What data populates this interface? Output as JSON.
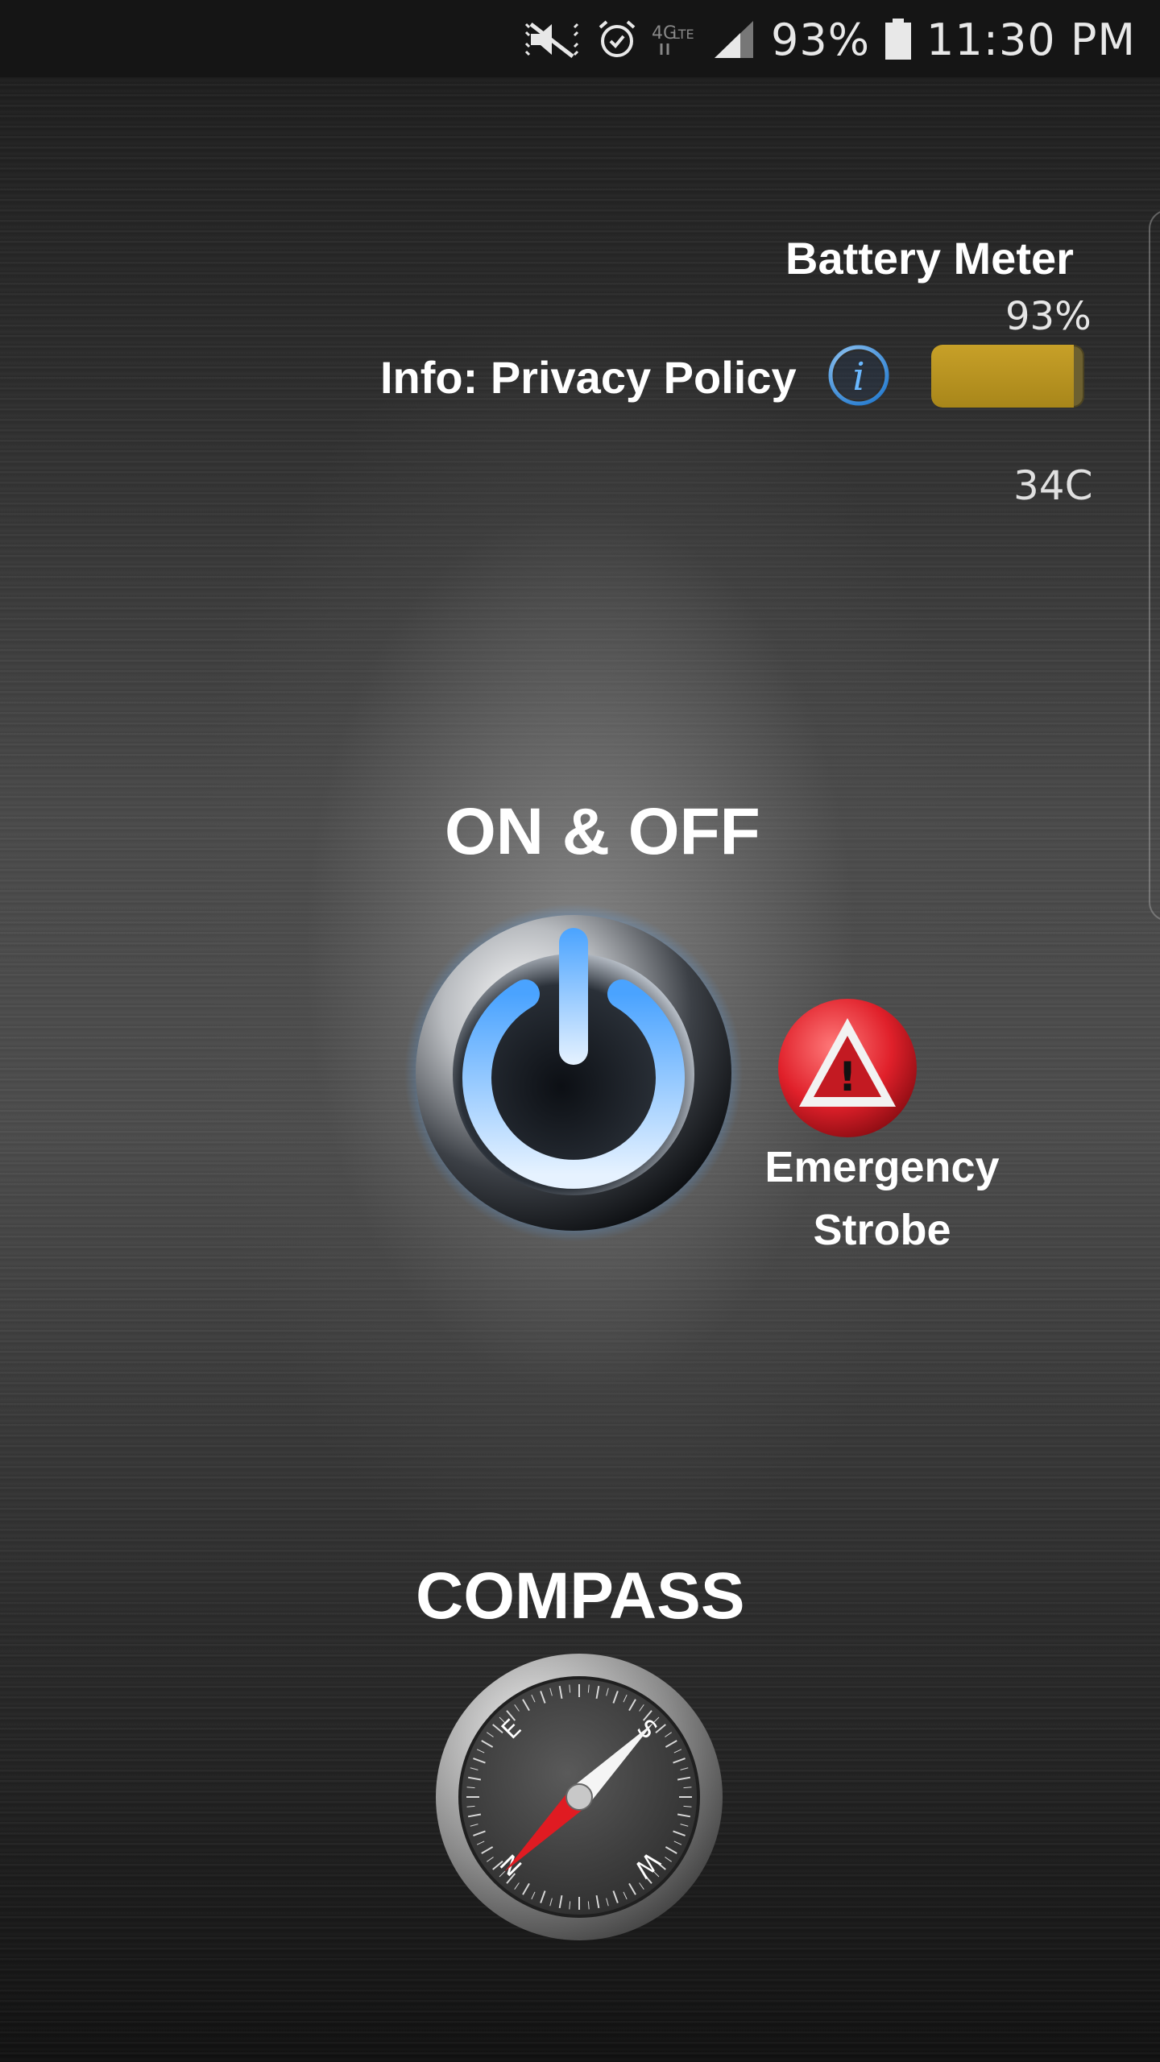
{
  "status_bar": {
    "battery_text": "93%",
    "time": "11:30 PM",
    "icons": [
      "mute-icon",
      "alarm-icon",
      "lte-icon",
      "signal-icon",
      "battery-icon"
    ]
  },
  "battery": {
    "title": "Battery Meter",
    "percent_label": "93%",
    "level": 0.93,
    "temperature": "34C",
    "fill_color": "#b8941f"
  },
  "info": {
    "privacy_label": "Info: Privacy Policy",
    "icon": "info-icon"
  },
  "power": {
    "label": "ON & OFF",
    "icon": "power-icon",
    "glow_color": "#4aa3ff"
  },
  "strobe": {
    "label_line1": "Emergency",
    "label_line2": "Strobe",
    "icon": "warning-icon",
    "color": "#e0202a"
  },
  "compass": {
    "label": "COMPASS",
    "icon": "compass-icon",
    "directions": [
      "N",
      "E",
      "S",
      "W"
    ]
  }
}
